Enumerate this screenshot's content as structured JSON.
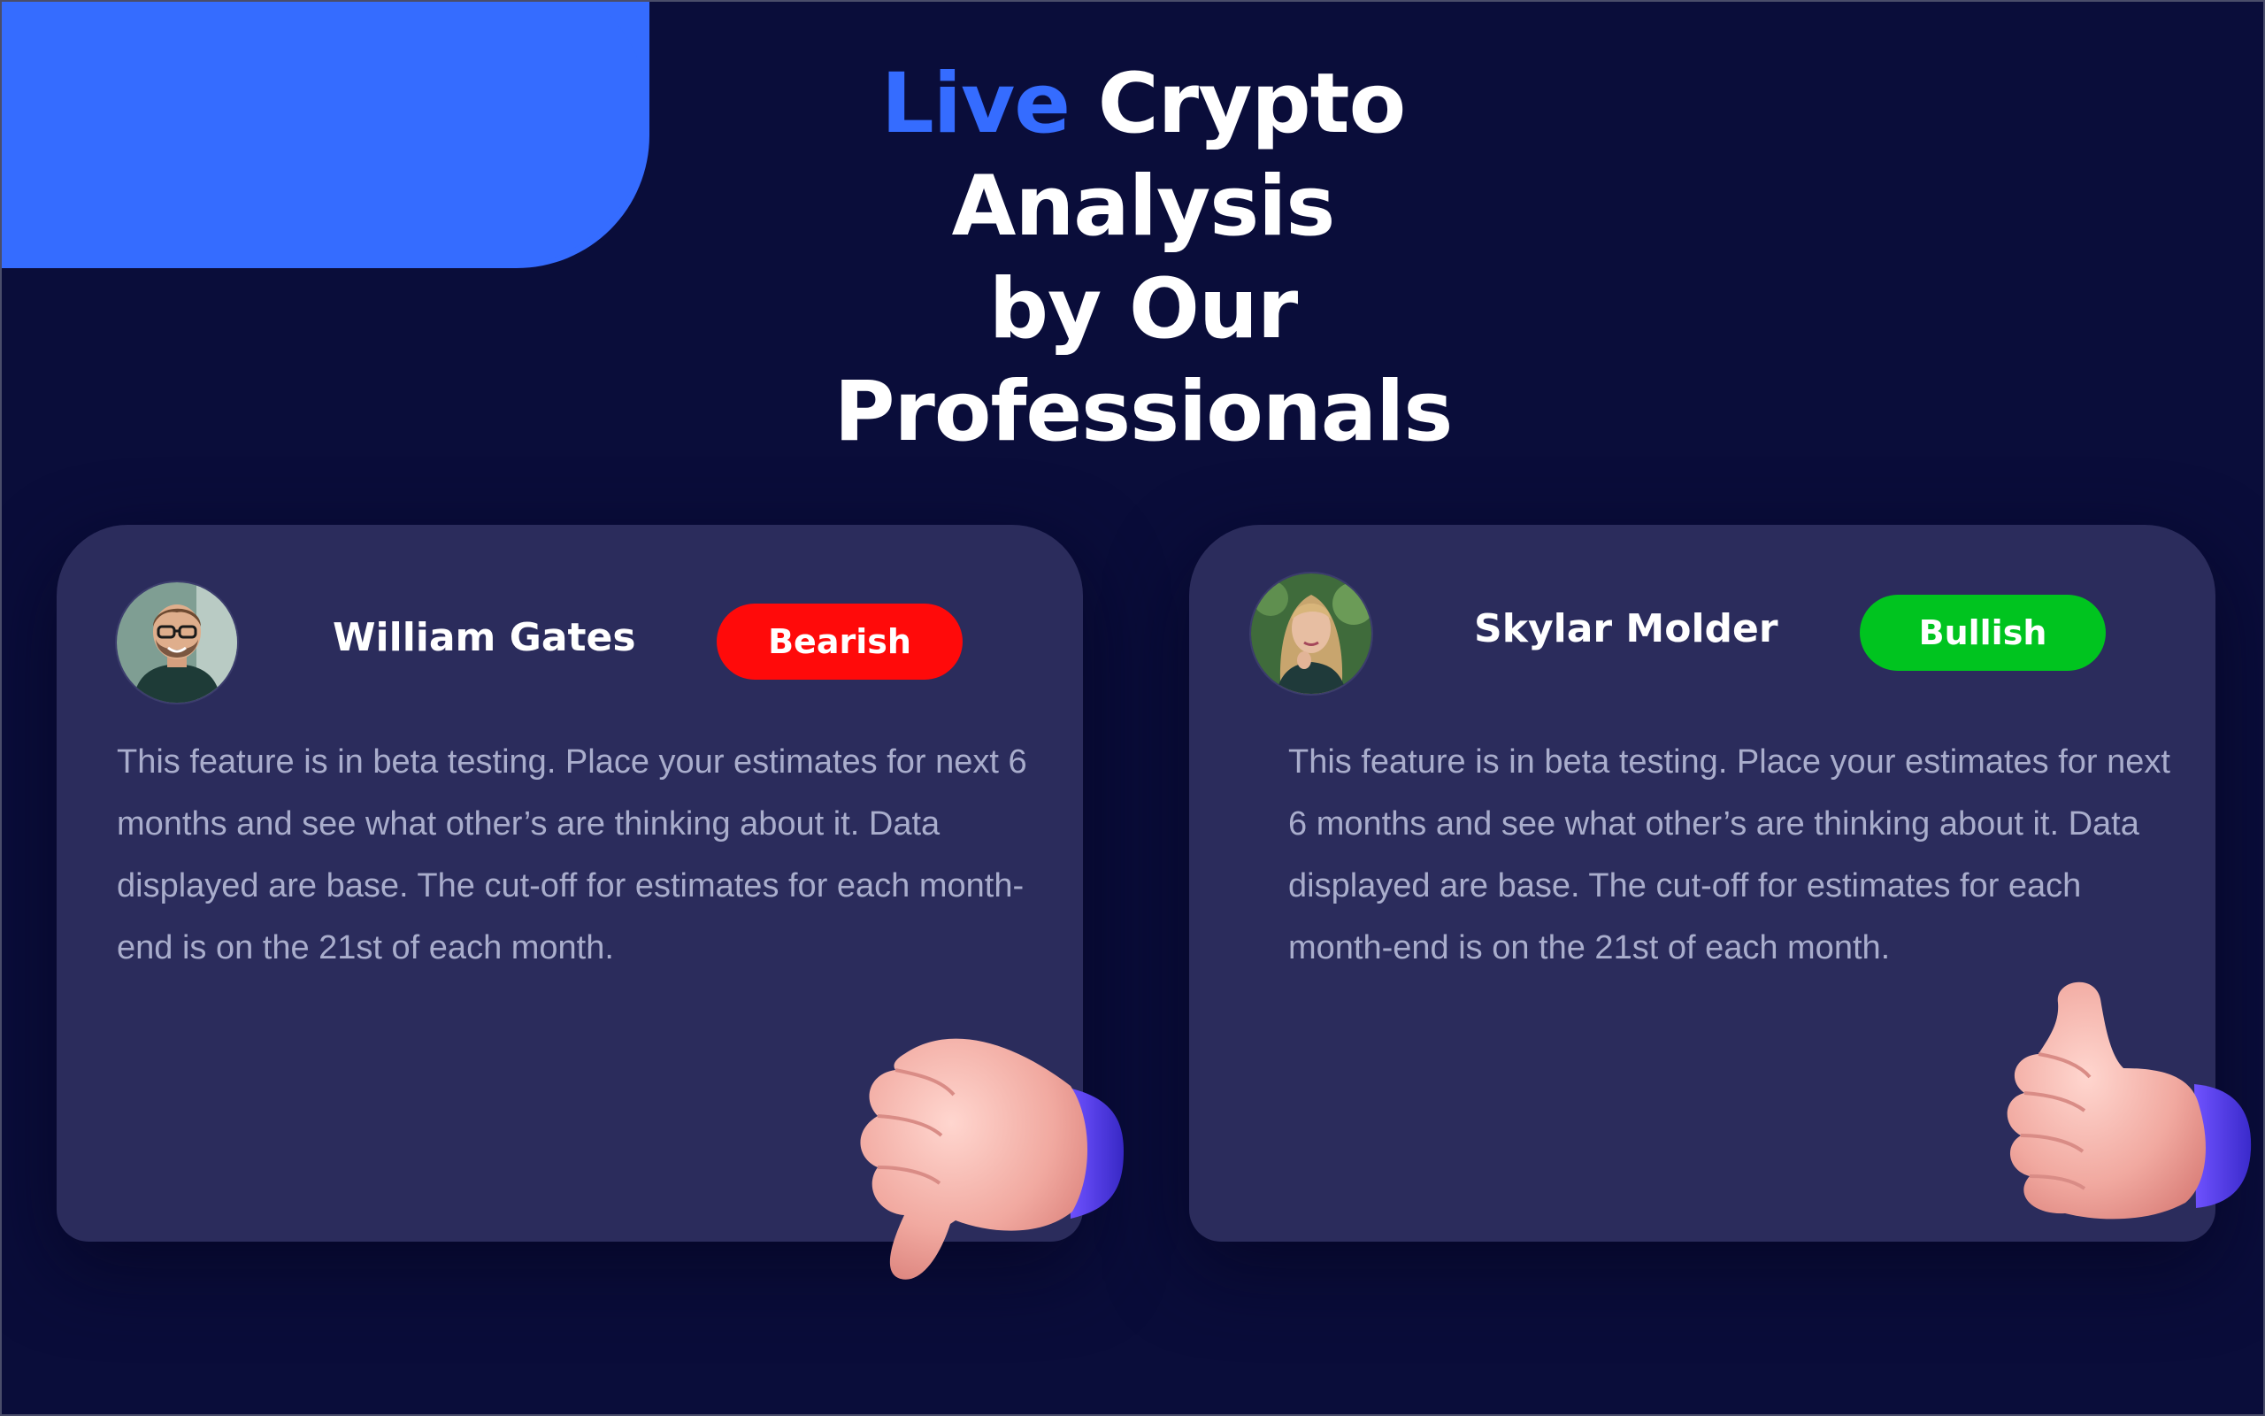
{
  "header": {
    "title_accent": "Live",
    "title_line1": " Crypto Analysis",
    "title_line2": "by Our Professionals"
  },
  "cards": [
    {
      "name": "William Gates",
      "sentiment": "Bearish",
      "sentiment_color": "#ff0a0a",
      "description": "This feature is in beta testing. Place your estimates for next 6 months and see what other’s are thinking about it. Data displayed are base. The cut-off for estimates for each month-end is on the 21st of each month.",
      "hand_icon": "thumbs-down-icon"
    },
    {
      "name": "Skylar Molder",
      "sentiment": "Bullish",
      "sentiment_color": "#00c41f",
      "description": "This feature is in beta testing. Place your estimates for next 6 months and see what other’s are thinking about it. Data displayed are base. The cut-off for estimates for each month-end is on the 21st of each month.",
      "hand_icon": "thumbs-up-icon"
    }
  ],
  "colors": {
    "background": "#0a0d3a",
    "accent": "#356cff",
    "card": "#2b2c5c",
    "bearish": "#ff0a0a",
    "bullish": "#00c41f"
  }
}
